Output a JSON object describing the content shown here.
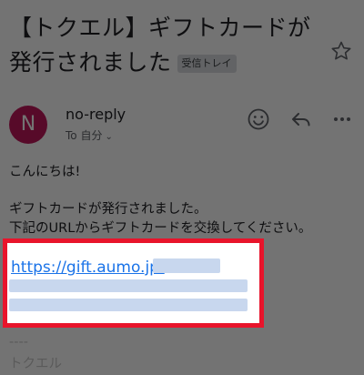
{
  "email": {
    "subject": "【トクエル】ギフトカードが発行されました",
    "label_badge": "受信トレイ",
    "sender_initial": "N",
    "sender_name": "no-reply",
    "recipient": "To 自分",
    "greeting": "こんにちは!",
    "line1": "ギフトカードが発行されました。",
    "line2": "下記のURLからギフトカードを交換してください。",
    "link_text": "https://gift.aumo.jp/",
    "separator": "----",
    "signature": "トクエル"
  },
  "icons": {
    "star": "star-icon",
    "emoji": "emoji-icon",
    "reply": "reply-icon",
    "more": "more-icon"
  },
  "colors": {
    "avatar": "#c2185b",
    "highlight": "#e8142b",
    "link": "#1a73e8"
  }
}
